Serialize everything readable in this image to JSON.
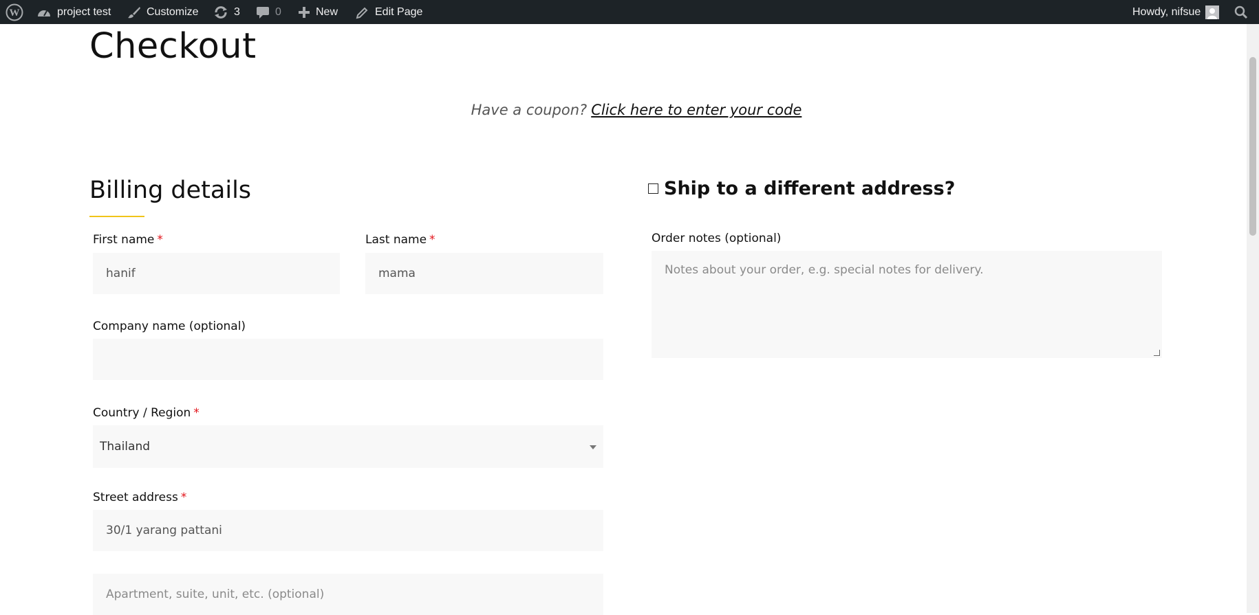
{
  "admin_bar": {
    "site_name": "project test",
    "customize": "Customize",
    "updates_count": "3",
    "comments_count": "0",
    "new_label": "New",
    "edit_page": "Edit Page",
    "howdy": "Howdy, nifsue"
  },
  "page": {
    "title": "Checkout",
    "coupon_text": "Have a coupon?",
    "coupon_link": "Click here to enter your code"
  },
  "billing": {
    "heading": "Billing details",
    "first_name_label": "First name",
    "first_name_value": "hanif",
    "last_name_label": "Last name",
    "last_name_value": "mama",
    "company_label": "Company name (optional)",
    "country_label": "Country / Region",
    "country_value": "Thailand",
    "street_label": "Street address",
    "street_value": "30/1 yarang pattani",
    "apartment_placeholder": "Apartment, suite, unit, etc. (optional)",
    "required_mark": "*"
  },
  "shipping": {
    "heading": "Ship to a different address?",
    "order_notes_label": "Order notes (optional)",
    "order_notes_placeholder": "Notes about your order, e.g. special notes for delivery."
  },
  "colors": {
    "admin_bar_bg": "#1d2327",
    "accent_underline": "#f0c419",
    "required": "#e2131a"
  }
}
